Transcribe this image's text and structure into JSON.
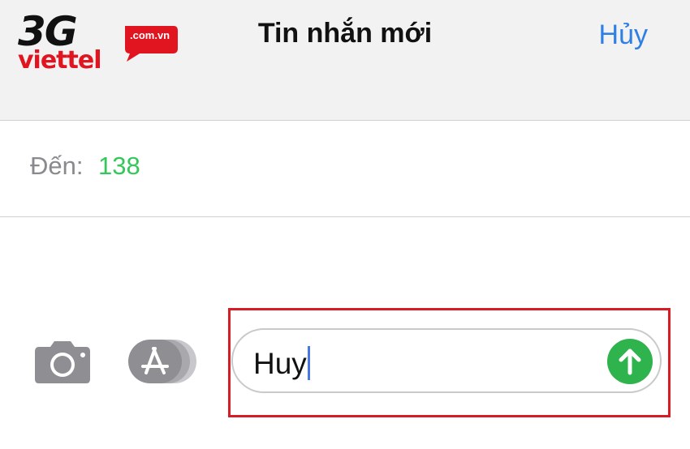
{
  "logo": {
    "brand_top": "3G",
    "brand_bottom": "viettel",
    "domain": ".com.vn"
  },
  "header": {
    "title": "Tin nhắn mới",
    "cancel_label": "Hủy"
  },
  "recipient": {
    "label": "Đến:",
    "value": "138"
  },
  "compose": {
    "message_text": "Huy"
  },
  "icons": {
    "camera": "camera-icon",
    "apps": "app-store-icon",
    "send": "send-arrow-icon"
  },
  "colors": {
    "accent_blue": "#2f80e4",
    "send_green": "#2fb34c",
    "recipient_green": "#34c759",
    "highlight_red": "#d71c25"
  }
}
